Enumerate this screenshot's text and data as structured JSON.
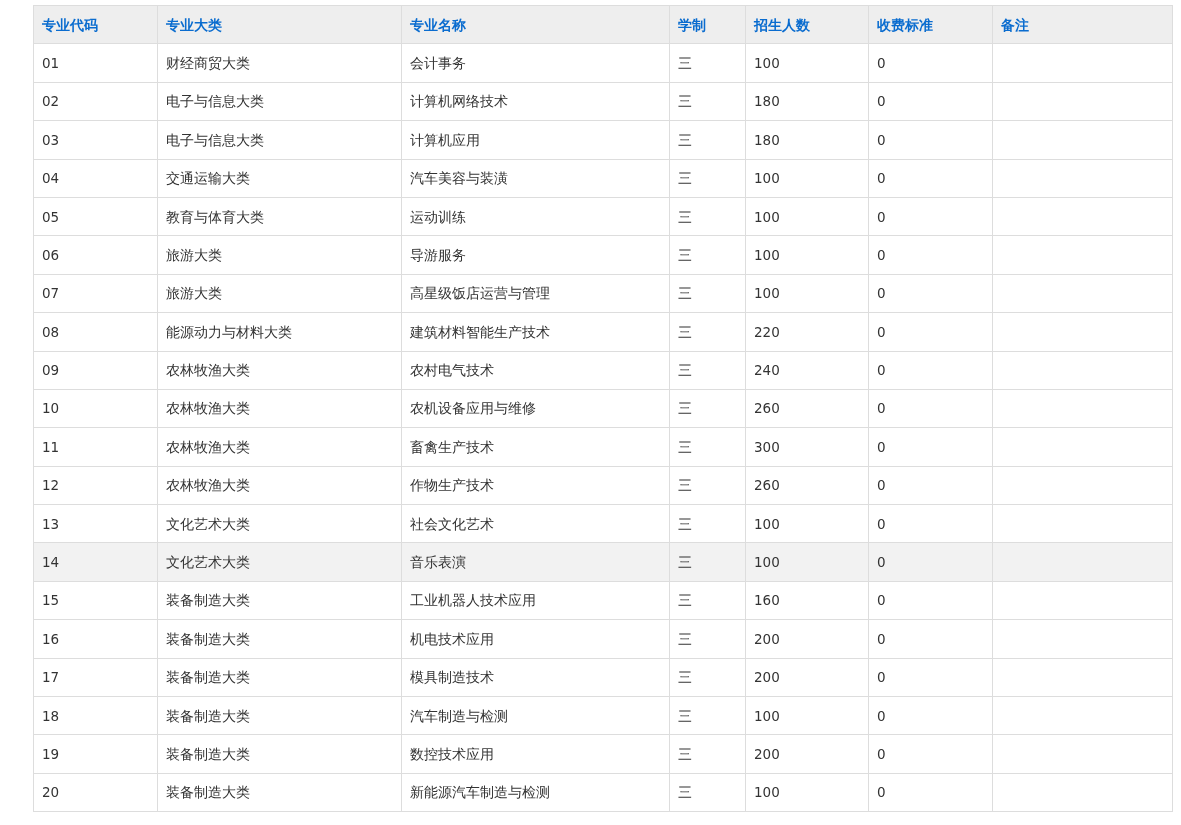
{
  "table": {
    "columns": [
      "专业代码",
      "专业大类",
      "专业名称",
      "学制",
      "招生人数",
      "收费标准",
      "备注"
    ],
    "rows": [
      {
        "cells": [
          "01",
          "财经商贸大类",
          "会计事务",
          "三",
          "100",
          "0",
          ""
        ],
        "highlighted": false
      },
      {
        "cells": [
          "02",
          "电子与信息大类",
          "计算机网络技术",
          "三",
          "180",
          "0",
          ""
        ],
        "highlighted": false
      },
      {
        "cells": [
          "03",
          "电子与信息大类",
          "计算机应用",
          "三",
          "180",
          "0",
          ""
        ],
        "highlighted": false
      },
      {
        "cells": [
          "04",
          "交通运输大类",
          "汽车美容与装潢",
          "三",
          "100",
          "0",
          ""
        ],
        "highlighted": false
      },
      {
        "cells": [
          "05",
          "教育与体育大类",
          "运动训练",
          "三",
          "100",
          "0",
          ""
        ],
        "highlighted": false
      },
      {
        "cells": [
          "06",
          "旅游大类",
          "导游服务",
          "三",
          "100",
          "0",
          ""
        ],
        "highlighted": false
      },
      {
        "cells": [
          "07",
          "旅游大类",
          "高星级饭店运营与管理",
          "三",
          "100",
          "0",
          ""
        ],
        "highlighted": false
      },
      {
        "cells": [
          "08",
          "能源动力与材料大类",
          "建筑材料智能生产技术",
          "三",
          "220",
          "0",
          ""
        ],
        "highlighted": false
      },
      {
        "cells": [
          "09",
          "农林牧渔大类",
          "农村电气技术",
          "三",
          "240",
          "0",
          ""
        ],
        "highlighted": false
      },
      {
        "cells": [
          "10",
          "农林牧渔大类",
          "农机设备应用与维修",
          "三",
          "260",
          "0",
          ""
        ],
        "highlighted": false
      },
      {
        "cells": [
          "11",
          "农林牧渔大类",
          "畜禽生产技术",
          "三",
          "300",
          "0",
          ""
        ],
        "highlighted": false
      },
      {
        "cells": [
          "12",
          "农林牧渔大类",
          "作物生产技术",
          "三",
          "260",
          "0",
          ""
        ],
        "highlighted": false
      },
      {
        "cells": [
          "13",
          "文化艺术大类",
          "社会文化艺术",
          "三",
          "100",
          "0",
          ""
        ],
        "highlighted": false
      },
      {
        "cells": [
          "14",
          "文化艺术大类",
          "音乐表演",
          "三",
          "100",
          "0",
          ""
        ],
        "highlighted": true
      },
      {
        "cells": [
          "15",
          "装备制造大类",
          "工业机器人技术应用",
          "三",
          "160",
          "0",
          ""
        ],
        "highlighted": false
      },
      {
        "cells": [
          "16",
          "装备制造大类",
          "机电技术应用",
          "三",
          "200",
          "0",
          ""
        ],
        "highlighted": false
      },
      {
        "cells": [
          "17",
          "装备制造大类",
          "模具制造技术",
          "三",
          "200",
          "0",
          ""
        ],
        "highlighted": false
      },
      {
        "cells": [
          "18",
          "装备制造大类",
          "汽车制造与检测",
          "三",
          "100",
          "0",
          ""
        ],
        "highlighted": false
      },
      {
        "cells": [
          "19",
          "装备制造大类",
          "数控技术应用",
          "三",
          "200",
          "0",
          ""
        ],
        "highlighted": false
      },
      {
        "cells": [
          "20",
          "装备制造大类",
          "新能源汽车制造与检测",
          "三",
          "100",
          "0",
          ""
        ],
        "highlighted": false
      }
    ]
  }
}
